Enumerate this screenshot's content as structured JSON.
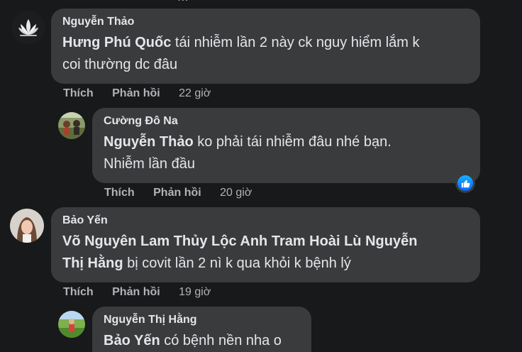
{
  "comments": [
    {
      "author": "Nguyễn Thảo",
      "mention": "Hưng Phú Quốc",
      "text_line1": " tái nhiễm lần 2 này ck nguy hiểm lắm k",
      "text_line2": "coi thường dc đâu",
      "like": "Thích",
      "reply": "Phản hồi",
      "time": "22 giờ"
    },
    {
      "author": "Cường Đô Na",
      "mention": "Nguyễn Thảo",
      "text_line1": " ko phải tái nhiễm đâu nhé bạn.",
      "text_line2": "Nhiễm lần đầu",
      "like": "Thích",
      "reply": "Phản hồi",
      "time": "20 giờ"
    },
    {
      "author": "Bảo Yến",
      "mention_line1": "Võ Nguyên Lam Thủy Lộc Anh Tram Hoài Lù Nguyễn",
      "mention_line2": "Thị Hằng",
      "text_line2": " bị covit lần 2 nì k qua khỏi k bệnh lý",
      "like": "Thích",
      "reply": "Phản hồi",
      "time": "19 giờ"
    },
    {
      "author": "Nguyễn Thị Hằng",
      "mention": "Bảo Yến",
      "text_line1": " có bệnh nền nha o"
    }
  ],
  "icons": {
    "like_reaction": "thumbs-up-icon",
    "avatar_lotus": "lotus-icon"
  },
  "colors": {
    "background": "#18191a",
    "bubble": "#3a3b3c",
    "text": "#e4e6eb",
    "secondary": "#b0b3b8",
    "like_blue": "#0866ff"
  }
}
